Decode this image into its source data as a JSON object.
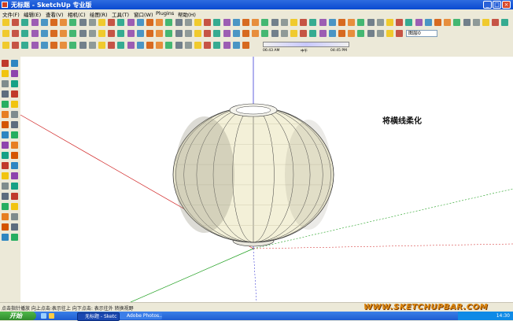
{
  "window": {
    "title": "无标题 - SketchUp 专业版",
    "min_label": "_",
    "max_label": "□",
    "close_label": "×"
  },
  "menu": {
    "items": [
      "文件(F)",
      "编辑(E)",
      "查看(V)",
      "相机(C)",
      "绘图(R)",
      "工具(T)",
      "窗口(W)",
      "Plugins",
      "帮助(H)"
    ]
  },
  "toolbar": {
    "layer_select_value": "图层0",
    "shadow_time_start": "06:43 AM",
    "shadow_time_mid": "中午",
    "shadow_time_end": "04:45 PM"
  },
  "viewport": {
    "annotation": "将横线柔化"
  },
  "status": {
    "text": "点击指针播放 向上点击:表示往上 向下点击: 表示往外 转换视野"
  },
  "watermark": {
    "text": "WWW.SKETCHUPBAR.COM"
  },
  "taskbar": {
    "start_label": "开始",
    "tasks": [
      {
        "label": "无标题 - Sketc"
      },
      {
        "label": "Adobe Photos..."
      }
    ],
    "clock": "14:30"
  },
  "colors": {
    "titlebar": "#0a4ad0",
    "chrome": "#ece9d8",
    "model_face": "#f3f0d8",
    "model_edge": "#3a3a3a",
    "axis_red": "#d02020",
    "axis_green": "#20a020",
    "axis_blue": "#2020d0"
  }
}
